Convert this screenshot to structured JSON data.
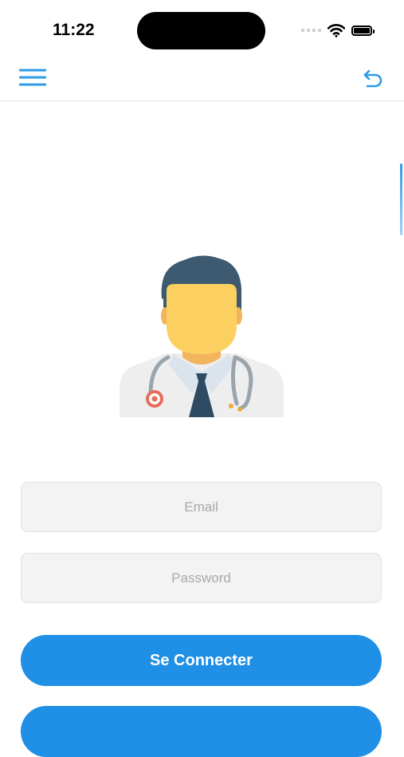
{
  "status_bar": {
    "time": "11:22"
  },
  "nav": {
    "menu_icon": "hamburger-menu-icon",
    "back_icon": "undo-arrow-icon",
    "accent_color": "#2d9be8"
  },
  "avatar": {
    "icon": "doctor-avatar-icon"
  },
  "form": {
    "email_placeholder": "Email",
    "password_placeholder": "Password",
    "login_label": "Se Connecter",
    "button_color": "#1f90e6"
  }
}
